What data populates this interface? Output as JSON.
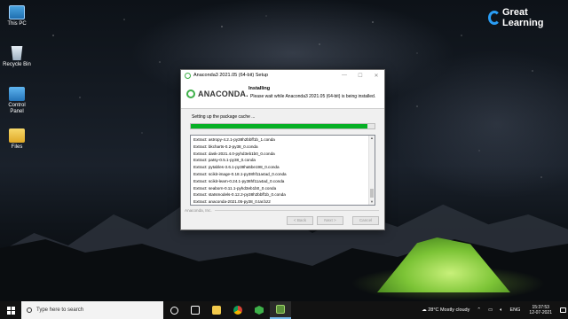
{
  "desktop": {
    "icons": [
      {
        "label": "This PC",
        "icon": "this-pc-icon"
      },
      {
        "label": "Recycle Bin",
        "icon": "recycle-bin-icon"
      },
      {
        "label": "Control Panel",
        "icon": "control-panel-icon"
      },
      {
        "label": "Files",
        "icon": "files-icon"
      }
    ],
    "logo": {
      "line1": "Great",
      "line2": "Learning",
      "color": "#2a9df4"
    }
  },
  "installer": {
    "window_title": "Anaconda3 2021.05 (64-bit) Setup",
    "brand": "ANACONDA.",
    "header_title": "Installing",
    "header_subtitle": "Please wait while Anaconda3 2021.05 (64-bit) is being installed.",
    "status": "Setting up the package cache ...",
    "progress_percent": 96,
    "progress_color": "#06b025",
    "log_lines": [
      "Extract: astropy-4.2.1-py38h2bbff1b_1.conda",
      "Extract: bkcharts-0.2-py38_0.conda",
      "Extract: dask-2021.4.0-pyhd3eb1b0_0.conda",
      "Extract: patsy-0.5.1-py38_0.conda",
      "Extract: pytables-3.6.1-py38ha5be198_0.conda",
      "Extract: scikit-image-0.18.1-py38hf11a4ad_0.conda",
      "Extract: scikit-learn-0.24.1-py38hf11a4ad_0.conda",
      "Extract: seaborn-0.11.1-pyhd3eb1b0_0.conda",
      "Extract: statsmodels-0.12.2-py38h2bbff1b_0.conda",
      "Extract: anaconda-2021.05-py38_0.tar.bz2"
    ],
    "footer_brand": "Anaconda, Inc.",
    "buttons": {
      "back": "< Back",
      "next": "Next >",
      "cancel": "Cancel"
    }
  },
  "taskbar": {
    "search_placeholder": "Type here to search",
    "weather": "28°C  Mostly cloudy",
    "language": "ENG",
    "time": "15:37:53",
    "date": "12-07-2021"
  }
}
